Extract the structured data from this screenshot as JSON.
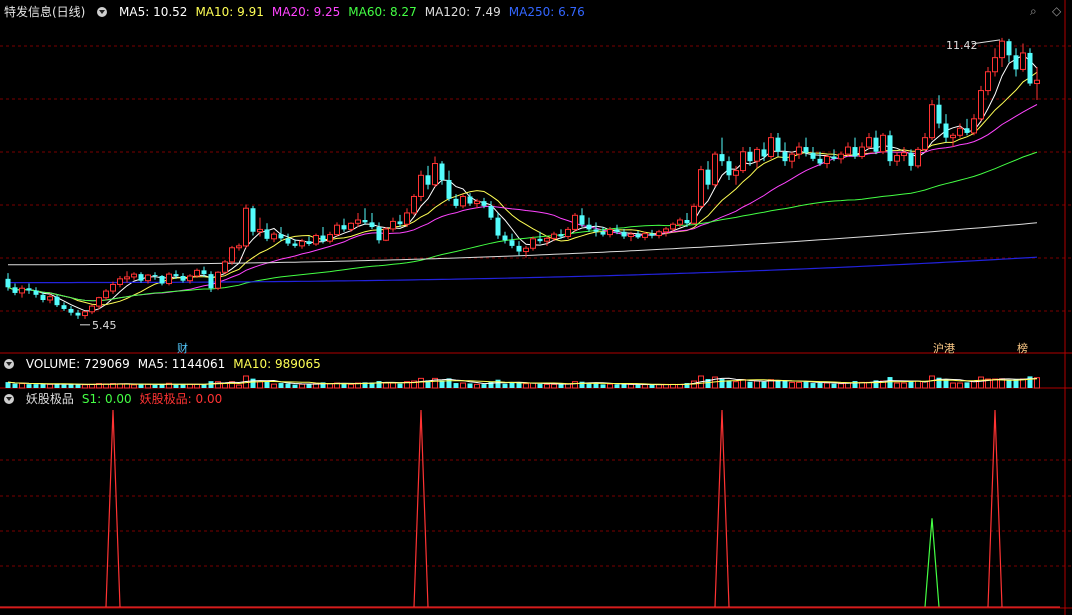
{
  "header": {
    "title": "特发信息(日线)",
    "ma_labels": [
      {
        "label": "MA5: 10.52",
        "color": "#ffffff"
      },
      {
        "label": "MA10: 9.91",
        "color": "#ffff55"
      },
      {
        "label": "MA20: 9.25",
        "color": "#ff44ff"
      },
      {
        "label": "MA60: 8.27",
        "color": "#44ff44"
      },
      {
        "label": "MA120: 7.49",
        "color": "#dddddd"
      },
      {
        "label": "MA250: 6.76",
        "color": "#3366ff"
      }
    ]
  },
  "volume_header": {
    "labels": [
      {
        "label": "VOLUME: 729069",
        "color": "#ffffff"
      },
      {
        "label": "MA5: 1144061",
        "color": "#ffffff"
      },
      {
        "label": "MA10: 989065",
        "color": "#ffff55"
      }
    ]
  },
  "indicator_header": {
    "labels": [
      {
        "label": "妖股极品",
        "color": "#dddddd"
      },
      {
        "label": "S1: 0.00",
        "color": "#44ff44"
      },
      {
        "label": "妖股极品: 0.00",
        "color": "#ff3333"
      }
    ]
  },
  "icons": [
    "dropdown-circle-icon",
    "search-icon",
    "diamond-icon"
  ],
  "colors": {
    "up": "#ff3333",
    "down": "#54fcfc",
    "grid": "#7a0000",
    "ma250": "#2222dd"
  },
  "chart_data": [
    {
      "type": "candlestick",
      "title": "特发信息(日线)",
      "annotations": [
        {
          "text": "11.42",
          "at_value": 11.42
        },
        {
          "text": "5.45",
          "at_value": 5.45
        },
        {
          "text": "财",
          "x_index": 25
        },
        {
          "text": "沪港",
          "x_index": 133
        },
        {
          "text": "榜",
          "x_index": 145
        }
      ],
      "ohlc": [
        [
          6.3,
          6.42,
          6.05,
          6.12
        ],
        [
          6.12,
          6.2,
          5.95,
          6.0
        ],
        [
          6.0,
          6.16,
          5.9,
          6.1
        ],
        [
          6.1,
          6.2,
          5.98,
          6.05
        ],
        [
          6.05,
          6.12,
          5.9,
          5.96
        ],
        [
          5.96,
          6.02,
          5.8,
          5.85
        ],
        [
          5.85,
          5.98,
          5.78,
          5.92
        ],
        [
          5.92,
          5.96,
          5.7,
          5.74
        ],
        [
          5.74,
          5.8,
          5.62,
          5.66
        ],
        [
          5.66,
          5.72,
          5.52,
          5.58
        ],
        [
          5.58,
          5.64,
          5.45,
          5.52
        ],
        [
          5.52,
          5.62,
          5.45,
          5.6
        ],
        [
          5.6,
          5.75,
          5.55,
          5.72
        ],
        [
          5.72,
          5.92,
          5.66,
          5.9
        ],
        [
          5.9,
          6.08,
          5.85,
          6.04
        ],
        [
          6.04,
          6.24,
          5.98,
          6.18
        ],
        [
          6.18,
          6.36,
          6.12,
          6.3
        ],
        [
          6.3,
          6.46,
          6.22,
          6.34
        ],
        [
          6.34,
          6.44,
          6.28,
          6.4
        ],
        [
          6.4,
          6.44,
          6.22,
          6.26
        ],
        [
          6.26,
          6.4,
          6.2,
          6.38
        ],
        [
          6.38,
          6.44,
          6.28,
          6.36
        ],
        [
          6.36,
          6.38,
          6.16,
          6.2
        ],
        [
          6.2,
          6.44,
          6.16,
          6.4
        ],
        [
          6.4,
          6.48,
          6.3,
          6.36
        ],
        [
          6.36,
          6.42,
          6.22,
          6.26
        ],
        [
          6.26,
          6.4,
          6.2,
          6.36
        ],
        [
          6.36,
          6.52,
          6.32,
          6.48
        ],
        [
          6.48,
          6.56,
          6.34,
          6.4
        ],
        [
          6.4,
          6.46,
          6.02,
          6.1
        ],
        [
          6.1,
          6.46,
          6.06,
          6.44
        ],
        [
          6.44,
          6.7,
          6.4,
          6.66
        ],
        [
          6.66,
          7.0,
          6.6,
          6.96
        ],
        [
          6.96,
          7.05,
          6.9,
          7.0
        ],
        [
          7.0,
          7.88,
          6.95,
          7.8
        ],
        [
          7.8,
          7.85,
          7.22,
          7.3
        ],
        [
          7.3,
          7.6,
          7.2,
          7.35
        ],
        [
          7.35,
          7.48,
          7.1,
          7.15
        ],
        [
          7.15,
          7.3,
          7.08,
          7.25
        ],
        [
          7.25,
          7.4,
          7.1,
          7.16
        ],
        [
          7.16,
          7.26,
          7.0,
          7.05
        ],
        [
          7.05,
          7.14,
          6.96,
          7.0
        ],
        [
          7.0,
          7.15,
          6.94,
          7.1
        ],
        [
          7.1,
          7.2,
          7.0,
          7.04
        ],
        [
          7.04,
          7.26,
          7.0,
          7.22
        ],
        [
          7.22,
          7.4,
          7.05,
          7.1
        ],
        [
          7.1,
          7.3,
          7.05,
          7.24
        ],
        [
          7.24,
          7.5,
          7.2,
          7.44
        ],
        [
          7.44,
          7.58,
          7.3,
          7.35
        ],
        [
          7.35,
          7.5,
          7.3,
          7.48
        ],
        [
          7.48,
          7.7,
          7.4,
          7.55
        ],
        [
          7.55,
          7.8,
          7.45,
          7.5
        ],
        [
          7.5,
          7.7,
          7.36,
          7.4
        ],
        [
          7.4,
          7.5,
          7.05,
          7.12
        ],
        [
          7.12,
          7.4,
          7.1,
          7.36
        ],
        [
          7.36,
          7.6,
          7.3,
          7.52
        ],
        [
          7.52,
          7.66,
          7.4,
          7.46
        ],
        [
          7.46,
          7.8,
          7.4,
          7.7
        ],
        [
          7.7,
          8.1,
          7.65,
          8.05
        ],
        [
          8.05,
          8.6,
          7.95,
          8.5
        ],
        [
          8.5,
          8.7,
          8.2,
          8.3
        ],
        [
          8.3,
          8.9,
          8.25,
          8.75
        ],
        [
          8.75,
          8.8,
          8.3,
          8.4
        ],
        [
          8.4,
          8.6,
          7.95,
          8.0
        ],
        [
          8.0,
          8.1,
          7.8,
          7.85
        ],
        [
          7.85,
          8.1,
          7.8,
          8.05
        ],
        [
          8.05,
          8.12,
          7.85,
          7.9
        ],
        [
          7.9,
          8.0,
          7.8,
          7.95
        ],
        [
          7.95,
          8.02,
          7.8,
          7.85
        ],
        [
          7.85,
          7.95,
          7.55,
          7.6
        ],
        [
          7.6,
          7.7,
          7.15,
          7.22
        ],
        [
          7.22,
          7.3,
          7.05,
          7.12
        ],
        [
          7.12,
          7.26,
          6.95,
          7.0
        ],
        [
          7.0,
          7.1,
          6.8,
          6.88
        ],
        [
          6.88,
          7.0,
          6.75,
          6.95
        ],
        [
          6.95,
          7.2,
          6.9,
          7.15
        ],
        [
          7.15,
          7.3,
          7.05,
          7.1
        ],
        [
          7.1,
          7.2,
          7.0,
          7.16
        ],
        [
          7.16,
          7.3,
          7.1,
          7.25
        ],
        [
          7.25,
          7.35,
          7.15,
          7.2
        ],
        [
          7.2,
          7.4,
          7.15,
          7.35
        ],
        [
          7.35,
          7.7,
          7.3,
          7.65
        ],
        [
          7.65,
          7.8,
          7.4,
          7.45
        ],
        [
          7.45,
          7.6,
          7.3,
          7.35
        ],
        [
          7.35,
          7.5,
          7.2,
          7.3
        ],
        [
          7.3,
          7.4,
          7.2,
          7.24
        ],
        [
          7.24,
          7.4,
          7.18,
          7.35
        ],
        [
          7.35,
          7.45,
          7.25,
          7.3
        ],
        [
          7.3,
          7.36,
          7.15,
          7.2
        ],
        [
          7.2,
          7.3,
          7.1,
          7.25
        ],
        [
          7.25,
          7.32,
          7.15,
          7.18
        ],
        [
          7.18,
          7.3,
          7.12,
          7.26
        ],
        [
          7.26,
          7.34,
          7.16,
          7.22
        ],
        [
          7.22,
          7.34,
          7.16,
          7.3
        ],
        [
          7.3,
          7.4,
          7.2,
          7.36
        ],
        [
          7.36,
          7.5,
          7.3,
          7.46
        ],
        [
          7.46,
          7.6,
          7.4,
          7.55
        ],
        [
          7.55,
          7.7,
          7.4,
          7.48
        ],
        [
          7.48,
          7.9,
          7.45,
          7.84
        ],
        [
          7.84,
          8.7,
          7.8,
          8.62
        ],
        [
          8.62,
          8.8,
          8.2,
          8.3
        ],
        [
          8.3,
          9.0,
          8.25,
          8.95
        ],
        [
          8.95,
          9.3,
          8.7,
          8.8
        ],
        [
          8.8,
          8.9,
          8.4,
          8.5
        ],
        [
          8.5,
          8.7,
          8.3,
          8.6
        ],
        [
          8.6,
          9.1,
          8.55,
          9.0
        ],
        [
          9.0,
          9.1,
          8.7,
          8.8
        ],
        [
          8.8,
          9.1,
          8.65,
          9.05
        ],
        [
          9.05,
          9.2,
          8.8,
          8.9
        ],
        [
          8.9,
          9.4,
          8.85,
          9.3
        ],
        [
          9.3,
          9.4,
          8.9,
          9.0
        ],
        [
          9.0,
          9.2,
          8.7,
          8.8
        ],
        [
          8.8,
          9.0,
          8.65,
          8.95
        ],
        [
          8.95,
          9.2,
          8.85,
          9.1
        ],
        [
          9.1,
          9.3,
          8.9,
          8.98
        ],
        [
          8.98,
          9.1,
          8.8,
          8.85
        ],
        [
          8.85,
          9.0,
          8.7,
          8.75
        ],
        [
          8.75,
          8.95,
          8.65,
          8.9
        ],
        [
          8.9,
          9.05,
          8.8,
          8.85
        ],
        [
          8.85,
          9.0,
          8.75,
          8.95
        ],
        [
          8.95,
          9.2,
          8.9,
          9.1
        ],
        [
          9.1,
          9.3,
          8.85,
          8.9
        ],
        [
          8.9,
          9.2,
          8.85,
          9.1
        ],
        [
          9.1,
          9.4,
          9.05,
          9.3
        ],
        [
          9.3,
          9.45,
          8.95,
          9.0
        ],
        [
          9.0,
          9.4,
          8.95,
          9.35
        ],
        [
          9.35,
          9.45,
          8.7,
          8.8
        ],
        [
          8.8,
          9.0,
          8.7,
          8.92
        ],
        [
          8.92,
          9.1,
          8.8,
          8.98
        ],
        [
          8.98,
          9.05,
          8.6,
          8.7
        ],
        [
          8.7,
          9.1,
          8.65,
          9.05
        ],
        [
          9.05,
          9.4,
          9.0,
          9.3
        ],
        [
          9.3,
          10.1,
          9.25,
          10.0
        ],
        [
          10.0,
          10.2,
          9.5,
          9.6
        ],
        [
          9.6,
          9.8,
          9.2,
          9.3
        ],
        [
          9.3,
          9.4,
          9.1,
          9.35
        ],
        [
          9.35,
          9.6,
          9.3,
          9.5
        ],
        [
          9.5,
          9.7,
          9.35,
          9.4
        ],
        [
          9.4,
          9.8,
          9.35,
          9.7
        ],
        [
          9.7,
          10.4,
          9.65,
          10.3
        ],
        [
          10.3,
          10.8,
          10.2,
          10.7
        ],
        [
          10.7,
          11.2,
          10.6,
          11.0
        ],
        [
          11.0,
          11.42,
          10.8,
          11.35
        ],
        [
          11.35,
          11.4,
          10.9,
          11.05
        ],
        [
          11.05,
          11.2,
          10.6,
          10.75
        ],
        [
          10.75,
          11.3,
          10.7,
          11.1
        ],
        [
          11.1,
          11.2,
          10.4,
          10.45
        ],
        [
          10.45,
          10.8,
          10.1,
          10.52
        ]
      ],
      "ma_series": [
        {
          "name": "MA5",
          "value": 10.52
        },
        {
          "name": "MA10",
          "value": 9.91
        },
        {
          "name": "MA20",
          "value": 9.25
        },
        {
          "name": "MA60",
          "value": 8.27
        },
        {
          "name": "MA120",
          "value": 7.49
        },
        {
          "name": "MA250",
          "value": 6.76
        }
      ]
    },
    {
      "type": "bar",
      "title": "VOLUME",
      "current": 729069,
      "ma5": 1144061,
      "ma10": 989065
    },
    {
      "type": "line",
      "title": "妖股极品",
      "series": [
        {
          "name": "S1",
          "color": "#44ff44",
          "spikes": [
            {
              "x_index": 132,
              "value": 0.45
            }
          ]
        },
        {
          "name": "妖股极品",
          "color": "#ff3333",
          "spikes": [
            {
              "x_index": 15,
              "value": 1.0
            },
            {
              "x_index": 59,
              "value": 1.0
            },
            {
              "x_index": 102,
              "value": 1.0
            },
            {
              "x_index": 141,
              "value": 1.0
            }
          ]
        }
      ],
      "ylim": [
        0,
        1
      ]
    }
  ]
}
